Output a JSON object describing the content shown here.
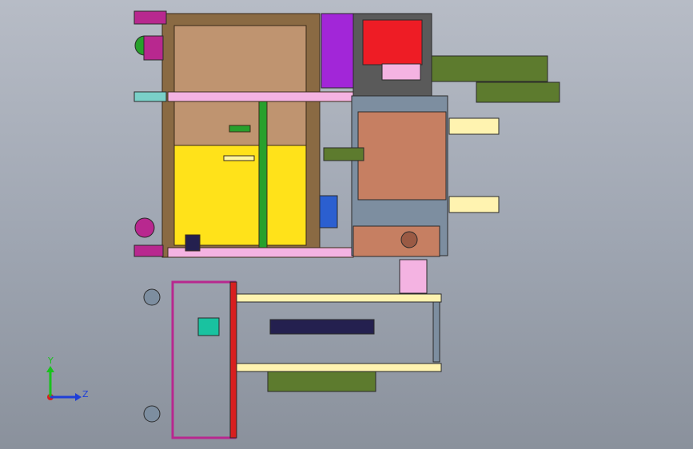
{
  "viewport": {
    "background_top": "#b7bcc6",
    "background_bottom": "#8a919c"
  },
  "triad": {
    "y_label": "Y",
    "z_label": "Z",
    "y_color": "#19c21c",
    "z_color": "#1f3fd8",
    "x_color": "#d81f1f"
  },
  "colors": {
    "tan": "#bf9470",
    "wood": "#8a6a43",
    "yellow": "#ffe21a",
    "green": "#28a02c",
    "red": "#ee1c25",
    "purple": "#a226d8",
    "olive": "#5d7b2e",
    "copper": "#c67f62",
    "pink": "#f4b3e2",
    "magenta": "#b8288f",
    "blue": "#2b5fd0",
    "steel": "#7d8ea0",
    "navy": "#24204f"
  }
}
